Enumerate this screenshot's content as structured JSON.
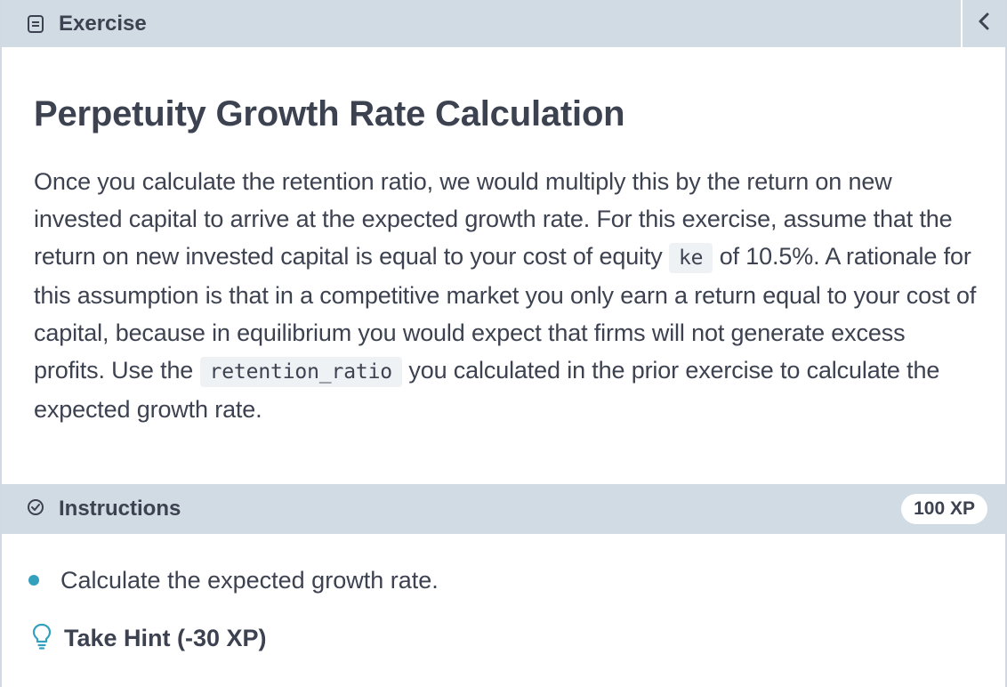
{
  "header": {
    "tab_label": "Exercise",
    "tab_icon": "document-icon",
    "collapse_icon": "chevron-left-icon"
  },
  "exercise": {
    "title": "Perpetuity Growth Rate Calculation",
    "para_part1": "Once you calculate the retention ratio, we would multiply this by the return on new invested capital to arrive at the expected growth rate. For this exercise, assume that the return on new invested capital is equal to your cost of equity ",
    "code1": "ke",
    "para_part2": " of 10.5%. A rationale for this assumption is that in a competitive market you only earn a return equal to your cost of capital, because in equilibrium you would expect that firms will not generate excess profits. Use the ",
    "code2": "retention_ratio",
    "para_part3": " you calculated in the prior exercise to calculate the expected growth rate."
  },
  "instructions": {
    "tab_label": "Instructions",
    "tab_icon": "check-circle-icon",
    "xp": "100 XP",
    "items": [
      "Calculate the expected growth rate."
    ],
    "bullet_color": "#33a1be"
  },
  "hint": {
    "label": "Take Hint (-30 XP)",
    "icon": "lightbulb-icon",
    "icon_color": "#33a1be"
  },
  "colors": {
    "bar_background": "#d1dbe3",
    "text": "#3d4251",
    "code_background": "#eef2f5"
  }
}
